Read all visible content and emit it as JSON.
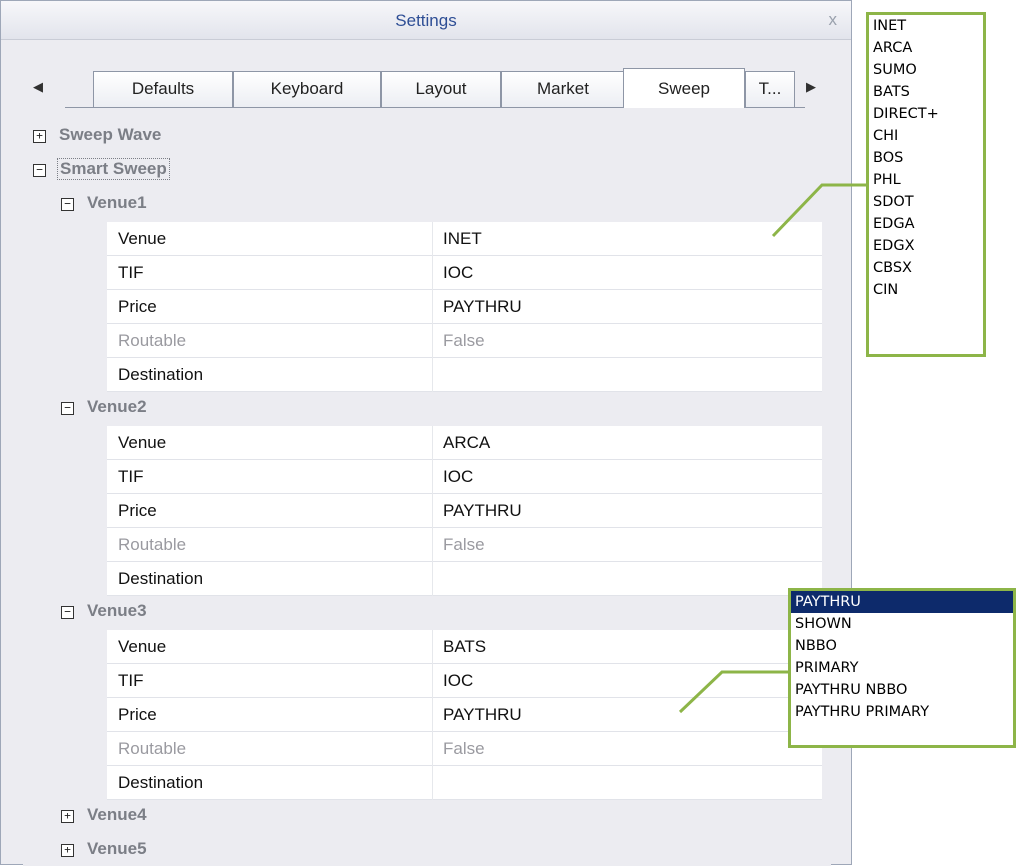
{
  "window": {
    "title": "Settings",
    "close_label": "x"
  },
  "tabs": [
    {
      "label": "Defaults",
      "active": false
    },
    {
      "label": "Keyboard",
      "active": false
    },
    {
      "label": "Layout",
      "active": false
    },
    {
      "label": "Market",
      "active": false
    },
    {
      "label": "Sweep",
      "active": true
    },
    {
      "label": "T...",
      "active": false
    }
  ],
  "tab_scroll": {
    "left": "◀",
    "right": "▶"
  },
  "tree": {
    "sweep_wave": {
      "label": "Sweep Wave",
      "toggle": "+"
    },
    "smart_sweep": {
      "label": "Smart Sweep",
      "toggle": "−"
    },
    "venues": [
      {
        "label": "Venue1",
        "toggle": "−",
        "props": [
          {
            "name": "Venue",
            "value": "INET"
          },
          {
            "name": "TIF",
            "value": "IOC"
          },
          {
            "name": "Price",
            "value": "PAYTHRU"
          },
          {
            "name": "Routable",
            "value": "False",
            "disabled": true
          },
          {
            "name": "Destination",
            "value": ""
          }
        ]
      },
      {
        "label": "Venue2",
        "toggle": "−",
        "props": [
          {
            "name": "Venue",
            "value": "ARCA"
          },
          {
            "name": "TIF",
            "value": "IOC"
          },
          {
            "name": "Price",
            "value": "PAYTHRU"
          },
          {
            "name": "Routable",
            "value": "False",
            "disabled": true
          },
          {
            "name": "Destination",
            "value": ""
          }
        ]
      },
      {
        "label": "Venue3",
        "toggle": "−",
        "props": [
          {
            "name": "Venue",
            "value": "BATS"
          },
          {
            "name": "TIF",
            "value": "IOC"
          },
          {
            "name": "Price",
            "value": "PAYTHRU"
          },
          {
            "name": "Routable",
            "value": "False",
            "disabled": true
          },
          {
            "name": "Destination",
            "value": ""
          }
        ]
      },
      {
        "label": "Venue4",
        "toggle": "+"
      },
      {
        "label": "Venue5",
        "toggle": "+"
      }
    ]
  },
  "venue_dropdown": {
    "options": [
      "INET",
      "ARCA",
      "SUMO",
      "BATS",
      "DIRECT+",
      "CHI",
      "BOS",
      "PHL",
      "SDOT",
      "EDGA",
      "EDGX",
      "CBSX",
      "CIN"
    ]
  },
  "price_dropdown": {
    "options": [
      "PAYTHRU",
      "SHOWN",
      "NBBO",
      "PRIMARY",
      "PAYTHRU NBBO",
      "PAYTHRU PRIMARY"
    ],
    "selected": "PAYTHRU"
  },
  "colors": {
    "callout_border": "#8db548",
    "selected_bg": "#0d2a6b",
    "title_text": "#2e4e95"
  }
}
